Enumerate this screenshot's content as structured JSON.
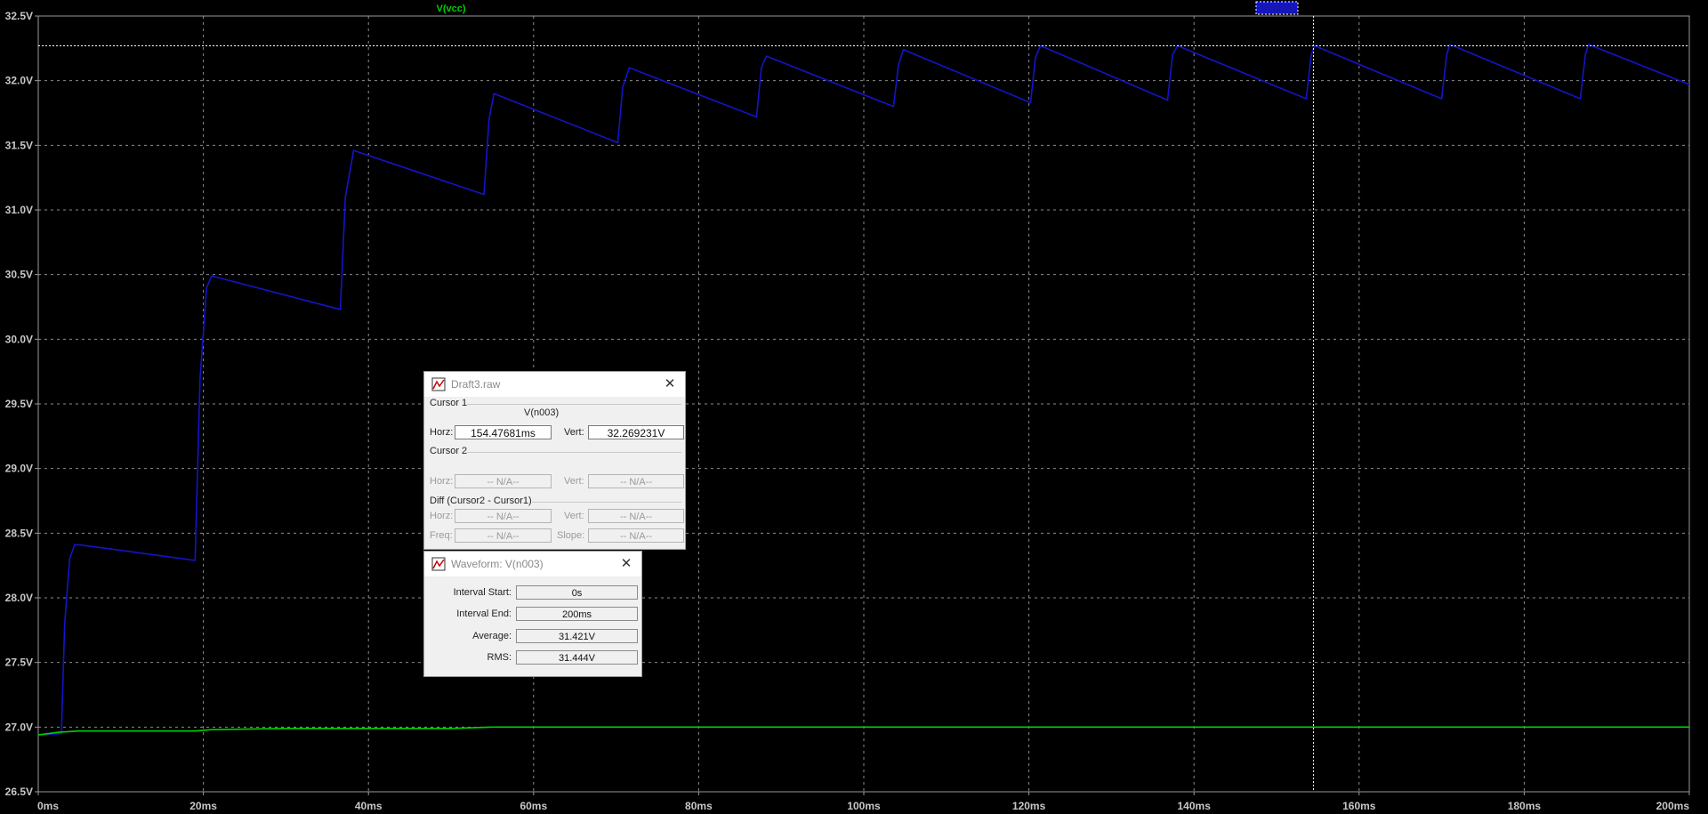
{
  "plot": {
    "traces": [
      {
        "label": "V(vcc)",
        "color": "#00d000"
      },
      {
        "label": "V(n003)",
        "color": "#1414c8"
      }
    ],
    "background": "#000000",
    "grid_color": "#8c8c8c",
    "axis_text_color": "#c8c8c8",
    "y_ticks": [
      "32.5V",
      "32.0V",
      "31.5V",
      "31.0V",
      "30.5V",
      "30.0V",
      "29.5V",
      "29.0V",
      "28.5V",
      "28.0V",
      "27.5V",
      "27.0V",
      "26.5V"
    ],
    "x_ticks": [
      "0ms",
      "20ms",
      "40ms",
      "60ms",
      "80ms",
      "100ms",
      "120ms",
      "140ms",
      "160ms",
      "180ms",
      "200ms"
    ]
  },
  "chart_data": {
    "type": "line",
    "title": "",
    "xlabel": "",
    "ylabel": "",
    "xlim": [
      0,
      200
    ],
    "ylim": [
      26.5,
      32.5
    ],
    "grid": true,
    "series": [
      {
        "name": "V(n003)",
        "x": [
          0,
          2.8,
          3.2,
          3.8,
          4.4,
          5.0,
          19.0,
          19.6,
          20.4,
          21.0,
          36.6,
          37.2,
          38.2,
          54.0,
          54.6,
          55.2,
          70.2,
          70.8,
          71.6,
          87.0,
          87.6,
          88.2,
          103.6,
          104.2,
          104.8,
          120.2,
          120.8,
          121.4,
          136.8,
          137.4,
          138.0,
          153.6,
          154.2,
          154.6,
          170.0,
          170.6,
          171.0,
          186.8,
          187.4,
          187.8,
          200
        ],
        "values": [
          26.94,
          26.95,
          27.8,
          28.3,
          28.41,
          28.41,
          28.29,
          29.7,
          30.4,
          30.49,
          30.23,
          31.1,
          31.46,
          31.12,
          31.7,
          31.9,
          31.52,
          31.95,
          32.1,
          31.72,
          32.1,
          32.19,
          31.8,
          32.12,
          32.24,
          31.83,
          32.18,
          32.27,
          31.85,
          32.2,
          32.27,
          31.86,
          32.2,
          32.27,
          31.86,
          32.2,
          32.28,
          31.86,
          32.2,
          32.28,
          31.97
        ]
      },
      {
        "name": "V(vcc)",
        "x": [
          0,
          2.5,
          5,
          10,
          19,
          21,
          30,
          40,
          50,
          55,
          60,
          70,
          80,
          100,
          120,
          140,
          160,
          180,
          200
        ],
        "values": [
          26.94,
          26.96,
          26.97,
          26.97,
          26.97,
          26.98,
          26.99,
          26.99,
          26.99,
          27.0,
          27.0,
          27.0,
          27.0,
          27.0,
          27.0,
          27.0,
          27.0,
          27.0,
          27.0
        ]
      }
    ],
    "cursor": {
      "x": 154.47681,
      "y": 32.269231
    }
  },
  "cursor_window": {
    "title": "Draft3.raw",
    "cursor1_label": "Cursor 1",
    "cursor1_trace": "V(n003)",
    "horz_label": "Horz:",
    "vert_label": "Vert:",
    "cursor1_horz": "154.47681ms",
    "cursor1_vert": "32.269231V",
    "cursor2_label": "Cursor 2",
    "na": "-- N/A--",
    "diff_label": "Diff (Cursor2 - Cursor1)",
    "freq_label": "Freq:",
    "slope_label": "Slope:"
  },
  "waveform_window": {
    "title": "Waveform: V(n003)",
    "interval_start_label": "Interval Start:",
    "interval_start": "0s",
    "interval_end_label": "Interval End:",
    "interval_end": "200ms",
    "average_label": "Average:",
    "average": "31.421V",
    "rms_label": "RMS:",
    "rms": "31.444V"
  }
}
